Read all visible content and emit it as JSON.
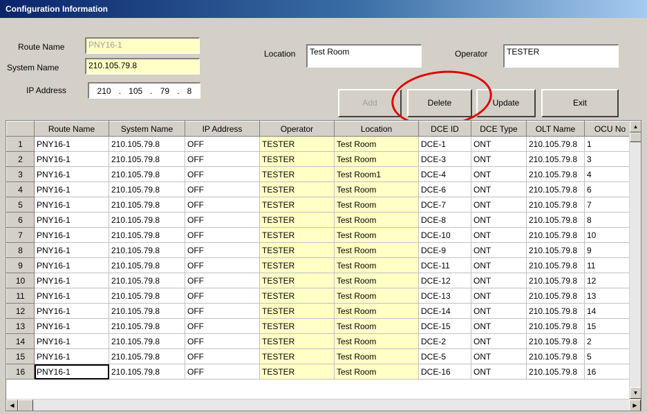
{
  "window": {
    "title": "Configuration Information"
  },
  "form": {
    "route_name_label": "Route Name",
    "route_name_value": "PNY16-1",
    "system_name_label": "System Name",
    "system_name_value": "210.105.79.8",
    "ip_label": "IP Address",
    "ip_octets": [
      "210",
      ".",
      "105",
      ".",
      "79",
      ".",
      "8"
    ],
    "location_label": "Location",
    "location_value": "Test Room",
    "operator_label": "Operator",
    "operator_value": "TESTER"
  },
  "buttons": {
    "add": "Add",
    "delete": "Delete",
    "update": "Update",
    "exit": "Exit"
  },
  "colors": {
    "highlight_yellow": "#ffffc6",
    "annotation_red": "#e00000",
    "title_blue": "#0a246a"
  },
  "table": {
    "columns": [
      "Route Name",
      "System Name",
      "IP Address",
      "Operator",
      "Location",
      "DCE ID",
      "DCE Type",
      "OLT Name",
      "OCU No"
    ],
    "rows": [
      {
        "n": "1",
        "route": "PNY16-1",
        "system": "210.105.79.8",
        "ip": "OFF",
        "operator": "TESTER",
        "location": "Test Room",
        "dce_id": "DCE-1",
        "dce_type": "ONT",
        "olt": "210.105.79.8",
        "ocu": "1"
      },
      {
        "n": "2",
        "route": "PNY16-1",
        "system": "210.105.79.8",
        "ip": "OFF",
        "operator": "TESTER",
        "location": "Test Room",
        "dce_id": "DCE-3",
        "dce_type": "ONT",
        "olt": "210.105.79.8",
        "ocu": "3"
      },
      {
        "n": "3",
        "route": "PNY16-1",
        "system": "210.105.79.8",
        "ip": "OFF",
        "operator": "TESTER",
        "location": "Test Room1",
        "dce_id": "DCE-4",
        "dce_type": "ONT",
        "olt": "210.105.79.8",
        "ocu": "4"
      },
      {
        "n": "4",
        "route": "PNY16-1",
        "system": "210.105.79.8",
        "ip": "OFF",
        "operator": "TESTER",
        "location": "Test Room",
        "dce_id": "DCE-6",
        "dce_type": "ONT",
        "olt": "210.105.79.8",
        "ocu": "6"
      },
      {
        "n": "5",
        "route": "PNY16-1",
        "system": "210.105.79.8",
        "ip": "OFF",
        "operator": "TESTER",
        "location": "Test Room",
        "dce_id": "DCE-7",
        "dce_type": "ONT",
        "olt": "210.105.79.8",
        "ocu": "7"
      },
      {
        "n": "6",
        "route": "PNY16-1",
        "system": "210.105.79.8",
        "ip": "OFF",
        "operator": "TESTER",
        "location": "Test Room",
        "dce_id": "DCE-8",
        "dce_type": "ONT",
        "olt": "210.105.79.8",
        "ocu": "8"
      },
      {
        "n": "7",
        "route": "PNY16-1",
        "system": "210.105.79.8",
        "ip": "OFF",
        "operator": "TESTER",
        "location": "Test Room",
        "dce_id": "DCE-10",
        "dce_type": "ONT",
        "olt": "210.105.79.8",
        "ocu": "10"
      },
      {
        "n": "8",
        "route": "PNY16-1",
        "system": "210.105.79.8",
        "ip": "OFF",
        "operator": "TESTER",
        "location": "Test Room",
        "dce_id": "DCE-9",
        "dce_type": "ONT",
        "olt": "210.105.79.8",
        "ocu": "9"
      },
      {
        "n": "9",
        "route": "PNY16-1",
        "system": "210.105.79.8",
        "ip": "OFF",
        "operator": "TESTER",
        "location": "Test Room",
        "dce_id": "DCE-11",
        "dce_type": "ONT",
        "olt": "210.105.79.8",
        "ocu": "11"
      },
      {
        "n": "10",
        "route": "PNY16-1",
        "system": "210.105.79.8",
        "ip": "OFF",
        "operator": "TESTER",
        "location": "Test Room",
        "dce_id": "DCE-12",
        "dce_type": "ONT",
        "olt": "210.105.79.8",
        "ocu": "12"
      },
      {
        "n": "11",
        "route": "PNY16-1",
        "system": "210.105.79.8",
        "ip": "OFF",
        "operator": "TESTER",
        "location": "Test Room",
        "dce_id": "DCE-13",
        "dce_type": "ONT",
        "olt": "210.105.79.8",
        "ocu": "13"
      },
      {
        "n": "12",
        "route": "PNY16-1",
        "system": "210.105.79.8",
        "ip": "OFF",
        "operator": "TESTER",
        "location": "Test Room",
        "dce_id": "DCE-14",
        "dce_type": "ONT",
        "olt": "210.105.79.8",
        "ocu": "14"
      },
      {
        "n": "13",
        "route": "PNY16-1",
        "system": "210.105.79.8",
        "ip": "OFF",
        "operator": "TESTER",
        "location": "Test Room",
        "dce_id": "DCE-15",
        "dce_type": "ONT",
        "olt": "210.105.79.8",
        "ocu": "15"
      },
      {
        "n": "14",
        "route": "PNY16-1",
        "system": "210.105.79.8",
        "ip": "OFF",
        "operator": "TESTER",
        "location": "Test Room",
        "dce_id": "DCE-2",
        "dce_type": "ONT",
        "olt": "210.105.79.8",
        "ocu": "2"
      },
      {
        "n": "15",
        "route": "PNY16-1",
        "system": "210.105.79.8",
        "ip": "OFF",
        "operator": "TESTER",
        "location": "Test Room",
        "dce_id": "DCE-5",
        "dce_type": "ONT",
        "olt": "210.105.79.8",
        "ocu": "5"
      },
      {
        "n": "16",
        "route": "PNY16-1",
        "system": "210.105.79.8",
        "ip": "OFF",
        "operator": "TESTER",
        "location": "Test Room",
        "dce_id": "DCE-16",
        "dce_type": "ONT",
        "olt": "210.105.79.8",
        "ocu": "16"
      }
    ]
  }
}
